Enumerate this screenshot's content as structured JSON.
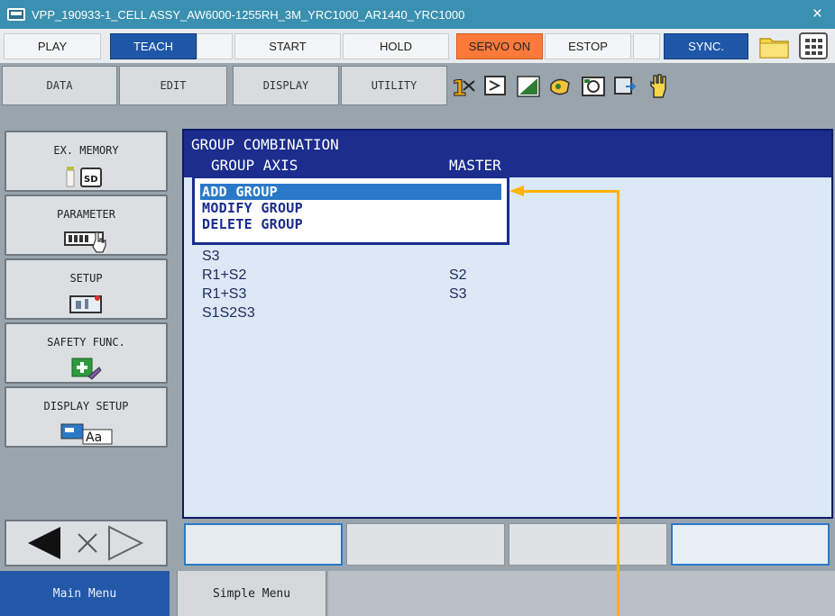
{
  "window": {
    "title": "VPP_190933-1_CELL ASSY_AW6000-1255RH_3M_YRC1000_AR1440_YRC1000",
    "close_label": "×"
  },
  "mode_bar": {
    "play": "PLAY",
    "teach": "TEACH",
    "start": "START",
    "hold": "HOLD",
    "servo_on": "SERVO ON",
    "estop": "ESTOP",
    "sync": "SYNC."
  },
  "menu_bar": {
    "data": "DATA",
    "edit": "EDIT",
    "display": "DISPLAY",
    "utility": "UTILITY"
  },
  "toolbar_icons": [
    "axis-icon",
    "coordinate-icon",
    "speed-icon",
    "tool-icon",
    "frame-icon",
    "page-icon",
    "hand-icon"
  ],
  "left_menu": [
    {
      "label": "EX. MEMORY",
      "icon": "sd-card-icon"
    },
    {
      "label": "PARAMETER",
      "icon": "parameter-icon"
    },
    {
      "label": "SETUP",
      "icon": "setup-icon"
    },
    {
      "label": "SAFETY FUNC.",
      "icon": "safety-icon"
    },
    {
      "label": "DISPLAY SETUP",
      "icon": "display-setup-icon"
    }
  ],
  "main": {
    "title": "GROUP COMBINATION",
    "col_group_axis": "GROUP AXIS",
    "col_master": "MASTER",
    "rows": [
      {
        "group": "S3",
        "master": ""
      },
      {
        "group": "R1+S2",
        "master": "S2"
      },
      {
        "group": "R1+S3",
        "master": "S3"
      },
      {
        "group": "S1S2S3",
        "master": ""
      }
    ]
  },
  "popup_menu": {
    "items": [
      "ADD GROUP",
      "MODIFY GROUP",
      "DELETE GROUP"
    ],
    "selected": "ADD GROUP"
  },
  "bottom_tabs": {
    "main_menu": "Main Menu",
    "simple_menu": "Simple Menu"
  },
  "colors": {
    "accent": "#1c2d8e",
    "selection": "#2a79c8",
    "callout": "#ffb300",
    "servo_on": "#ff7a3a",
    "teach": "#1f57a8"
  }
}
